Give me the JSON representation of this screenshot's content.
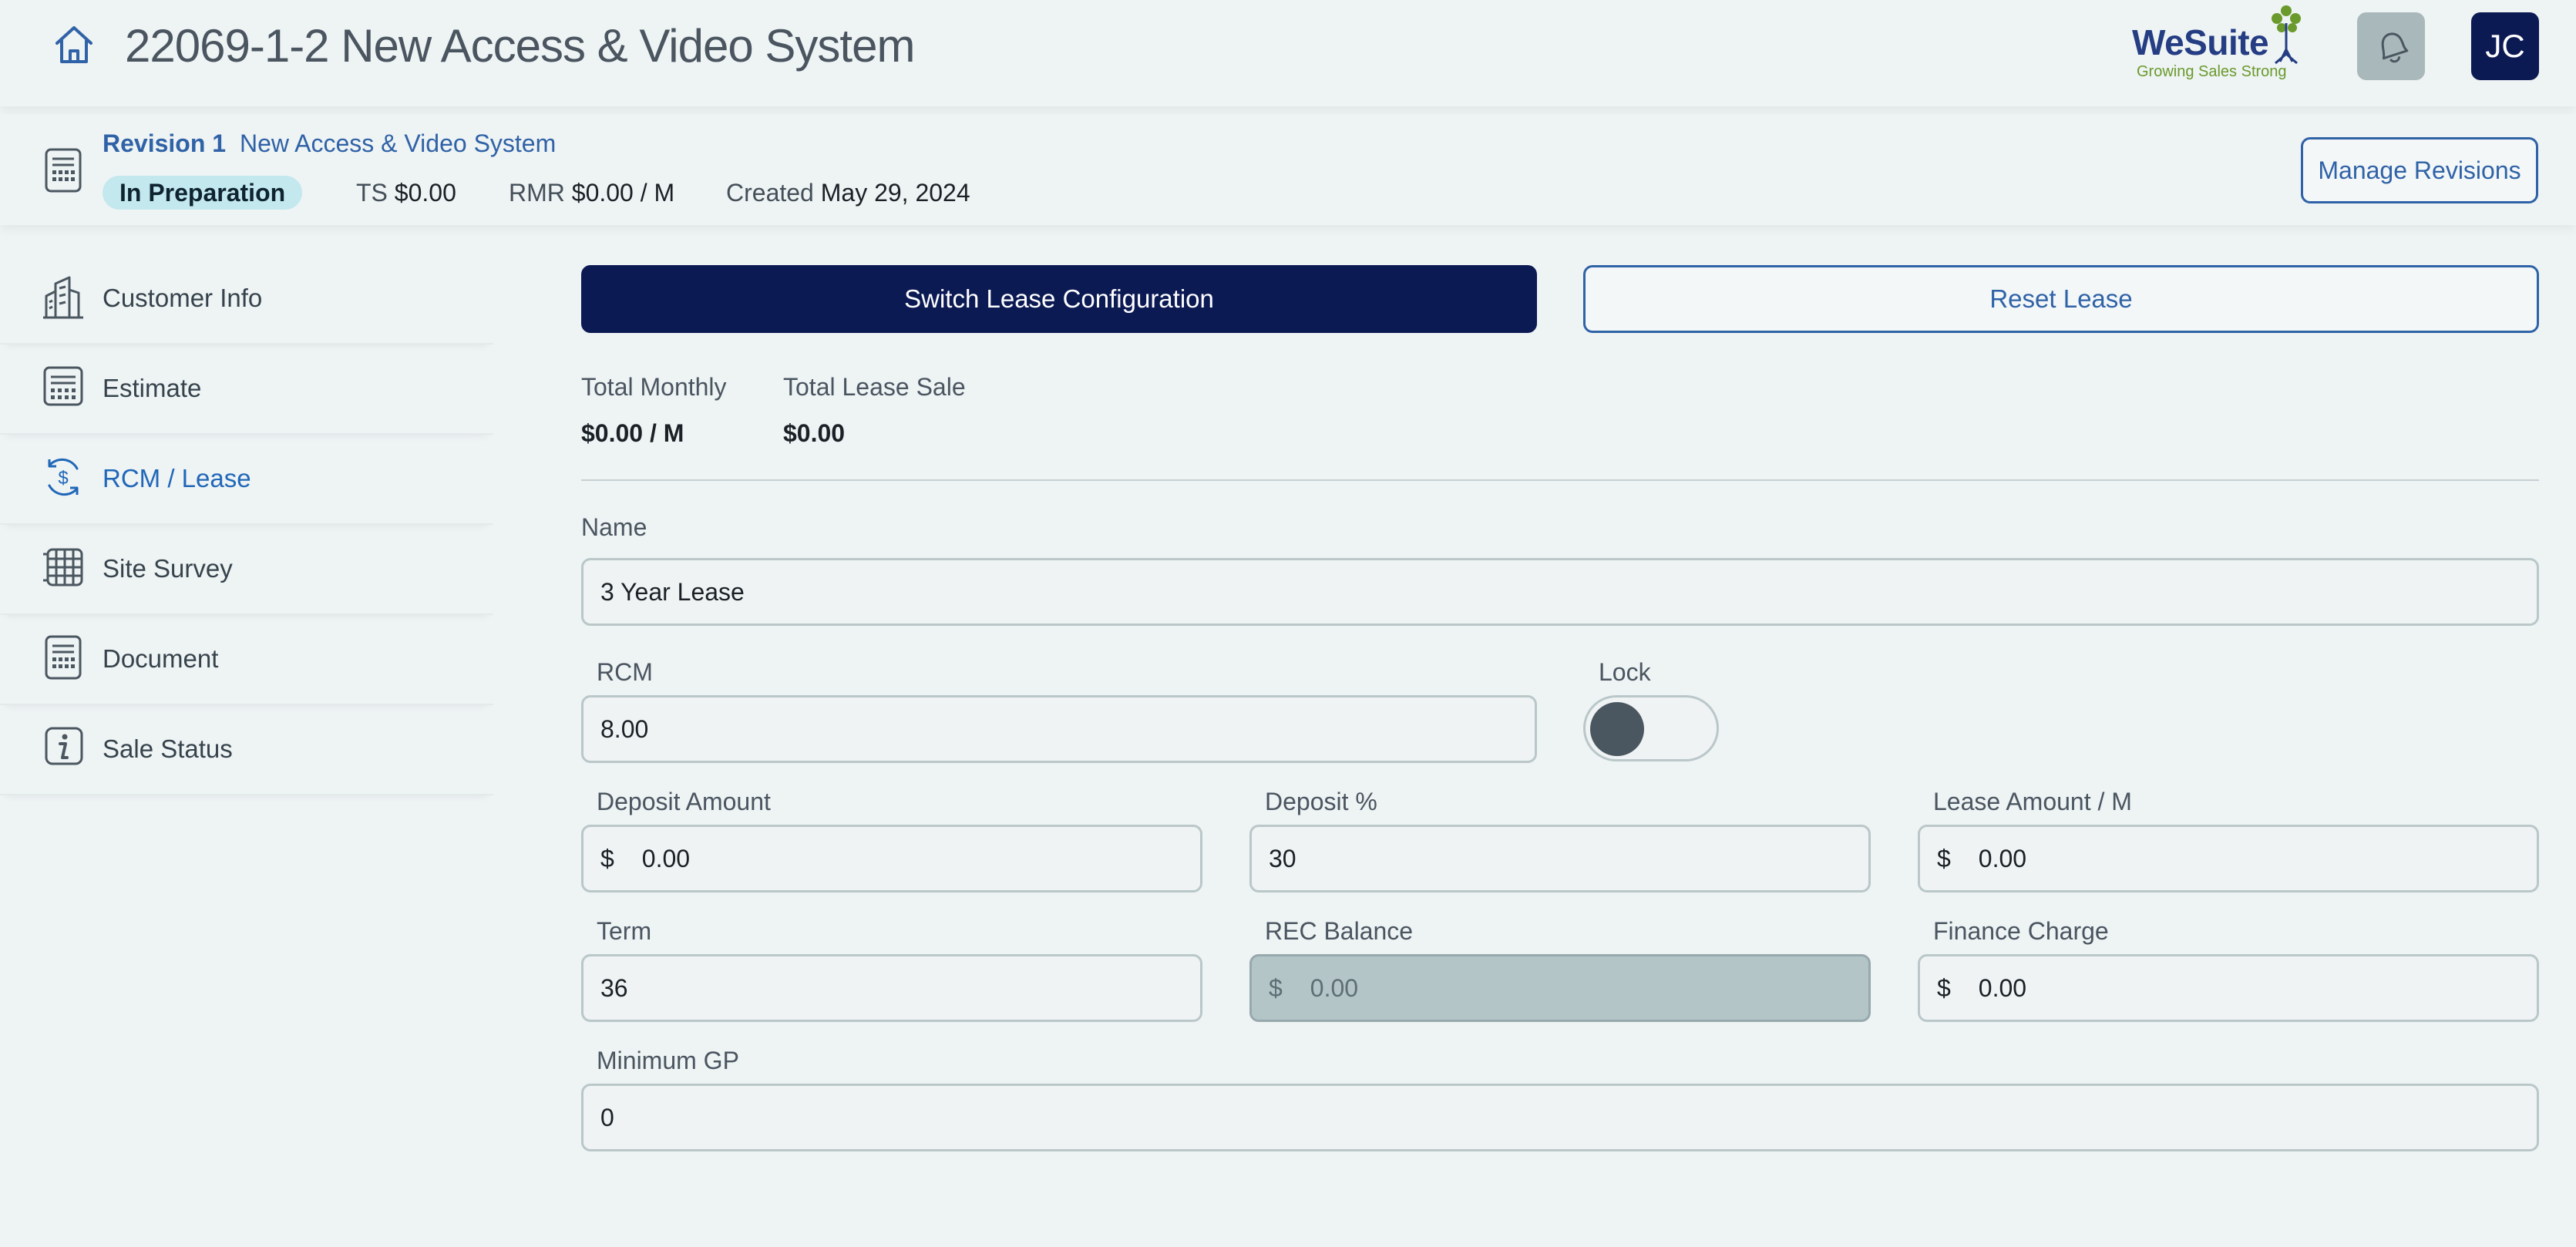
{
  "header": {
    "title": "22069-1-2 New Access & Video System",
    "logo": {
      "name": "WeSuite",
      "tagline": "Growing Sales Strong"
    },
    "avatar_initials": "JC"
  },
  "revision": {
    "label": "Revision 1",
    "name": "New Access & Video System",
    "status": "In Preparation",
    "ts_label": "TS",
    "ts_value": "$0.00",
    "rmr_label": "RMR",
    "rmr_value": "$0.00 / M",
    "created_label": "Created",
    "created_value": "May 29, 2024",
    "manage_label": "Manage Revisions"
  },
  "sidebar": {
    "items": [
      {
        "label": "Customer Info",
        "icon": "building-icon"
      },
      {
        "label": "Estimate",
        "icon": "calculator-icon"
      },
      {
        "label": "RCM / Lease",
        "icon": "recurring-dollar-icon",
        "active": true
      },
      {
        "label": "Site Survey",
        "icon": "grid-icon"
      },
      {
        "label": "Document",
        "icon": "document-icon"
      },
      {
        "label": "Sale Status",
        "icon": "info-icon"
      }
    ]
  },
  "main": {
    "switch_label": "Switch Lease Configuration",
    "reset_label": "Reset Lease",
    "summary": {
      "total_monthly_label": "Total Monthly",
      "total_monthly_value": "$0.00 / M",
      "total_lease_label": "Total Lease Sale",
      "total_lease_value": "$0.00"
    },
    "fields": {
      "name_label": "Name",
      "name_value": "3 Year Lease",
      "rcm_label": "RCM",
      "rcm_value": "8.00",
      "lock_label": "Lock",
      "lock_on": false,
      "deposit_amount_label": "Deposit Amount",
      "deposit_amount_value": "0.00",
      "deposit_pct_label": "Deposit %",
      "deposit_pct_value": "30",
      "lease_amount_label": "Lease Amount / M",
      "lease_amount_value": "0.00",
      "term_label": "Term",
      "term_value": "36",
      "rec_balance_label": "REC Balance",
      "rec_balance_value": "0.00",
      "finance_charge_label": "Finance Charge",
      "finance_charge_value": "0.00",
      "min_gp_label": "Minimum GP",
      "min_gp_value": "0",
      "currency_symbol": "$"
    }
  },
  "colors": {
    "background": "#eef3f4",
    "navy": "#0c1a54",
    "accent_blue": "#2f62a6",
    "badge_bg": "#c3e8ee",
    "logo_green": "#6a9a2c"
  }
}
